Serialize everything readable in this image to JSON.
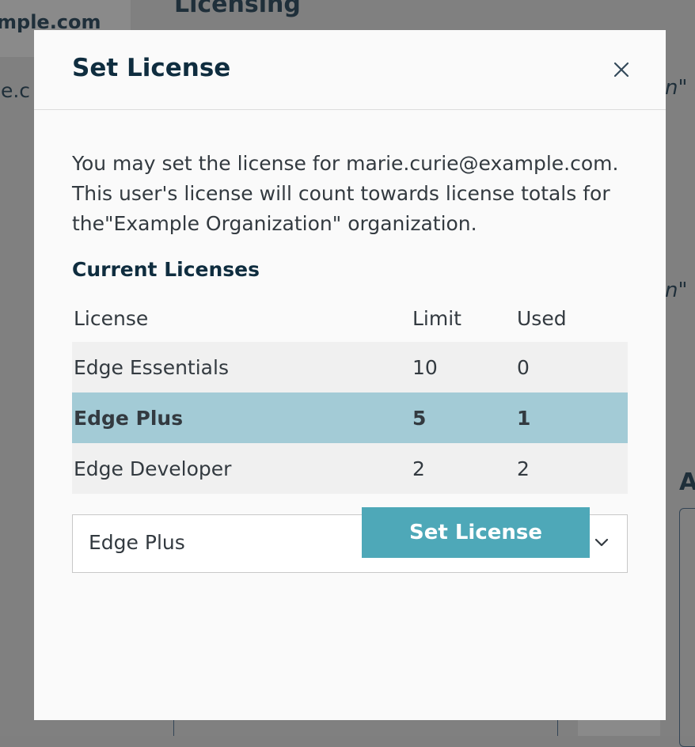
{
  "background": {
    "email_fragment_1": "mple.com",
    "email_fragment_2": "ie.c",
    "heading_fragment": "Licensing",
    "quote_fragment_1": "n\" c",
    "quote_fragment_2": "n\" c",
    "letter_fragment": "A"
  },
  "modal": {
    "title": "Set License",
    "close_icon": "close-icon",
    "intro": "You may set the license for marie.curie@example.com. This user's license will count towards license totals for the\"Example Organization\" organization.",
    "section_title": "Current Licenses",
    "table": {
      "headers": [
        "License",
        "Limit",
        "Used"
      ],
      "rows": [
        {
          "license": "Edge Essentials",
          "limit": "10",
          "used": "0"
        },
        {
          "license": "Edge Plus",
          "limit": "5",
          "used": "1"
        },
        {
          "license": "Edge Developer",
          "limit": "2",
          "used": "2"
        }
      ],
      "selected_row": "Edge Plus"
    },
    "select": {
      "value": "Edge Plus",
      "icon": "chevron-down-icon"
    },
    "submit_label": "Set License"
  },
  "colors": {
    "title": "#0f2d3f",
    "selected_row": "#a3cbd6",
    "button": "#4ea8b8",
    "overlay": "#808080"
  }
}
